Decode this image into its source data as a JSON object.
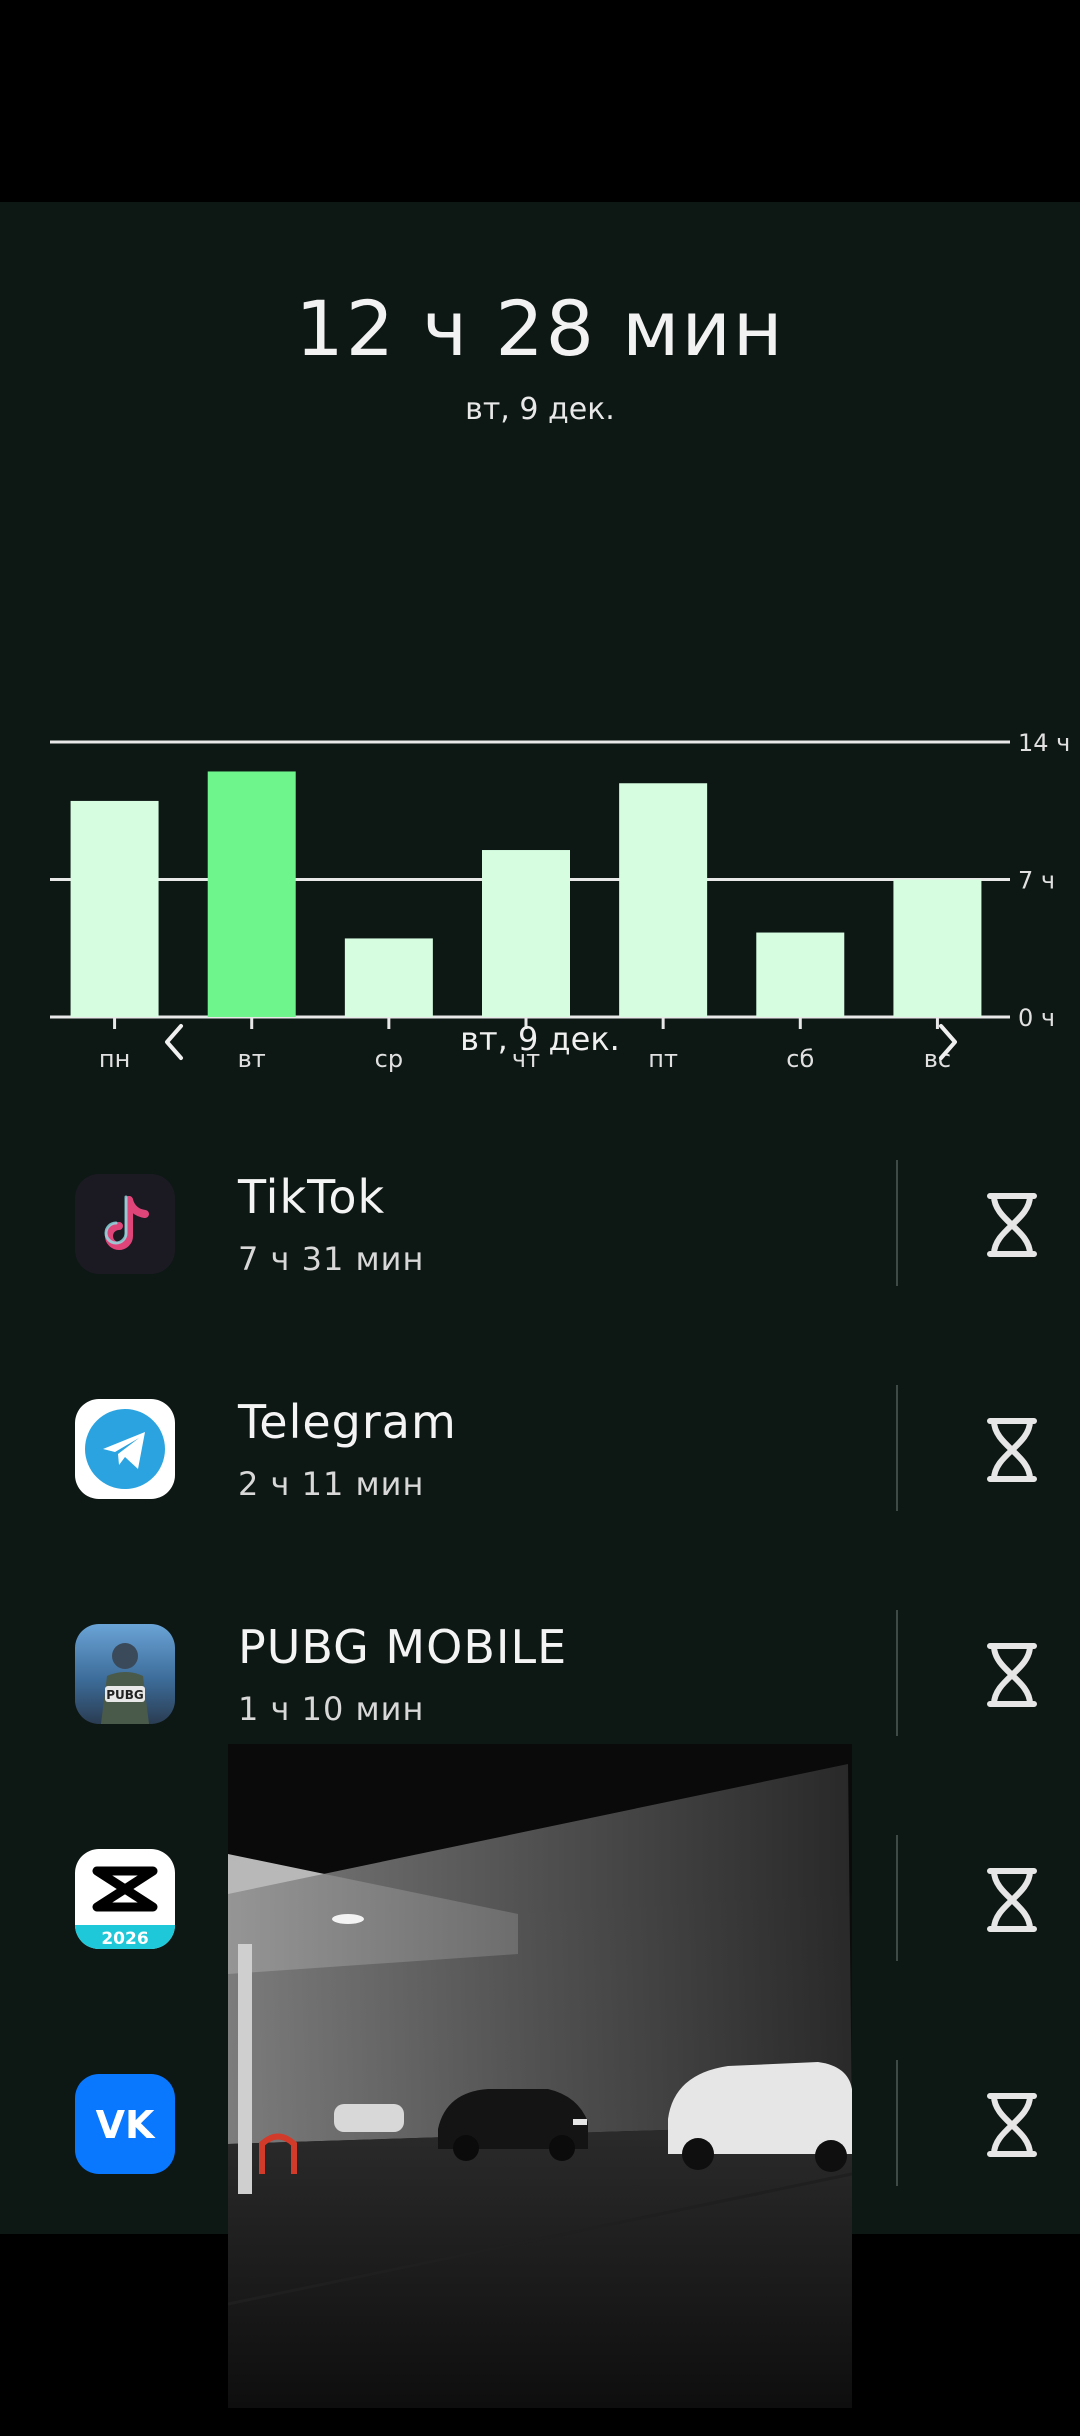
{
  "summary": {
    "total_time": "12 ч 28 мин",
    "date": "вт, 9 дек."
  },
  "chart_data": {
    "type": "bar",
    "categories": [
      "пн",
      "вт",
      "ср",
      "чт",
      "пт",
      "сб",
      "вс"
    ],
    "values": [
      11.0,
      12.5,
      4.0,
      8.5,
      11.9,
      4.3,
      7.0
    ],
    "highlight_index": 1,
    "yticks": [
      "0 ч",
      "7 ч",
      "14 ч"
    ],
    "ylim": [
      0,
      14
    ],
    "colors": {
      "bar": "#d6fde0",
      "highlight": "#6ef58c",
      "grid": "#e8e8e8"
    }
  },
  "nav": {
    "date": "вт, 9 дек.",
    "prev_icon": "chevron-left-icon",
    "next_icon": "chevron-right-icon"
  },
  "apps": [
    {
      "name": "TikTok",
      "time": "7 ч 31 мин",
      "icon": "tiktok-icon"
    },
    {
      "name": "Telegram",
      "time": "2 ч 11 мин",
      "icon": "telegram-icon"
    },
    {
      "name": "PUBG MOBILE",
      "time": "1 ч 10 мин",
      "icon": "pubg-icon"
    },
    {
      "name": "",
      "time": "",
      "icon": "capcut-icon",
      "badge": "2026"
    },
    {
      "name": "",
      "time": "",
      "icon": "vk-icon"
    }
  ],
  "timer_icon": "hourglass-icon",
  "overlay": {
    "type": "video-overlay",
    "scene": "night parking garage"
  }
}
